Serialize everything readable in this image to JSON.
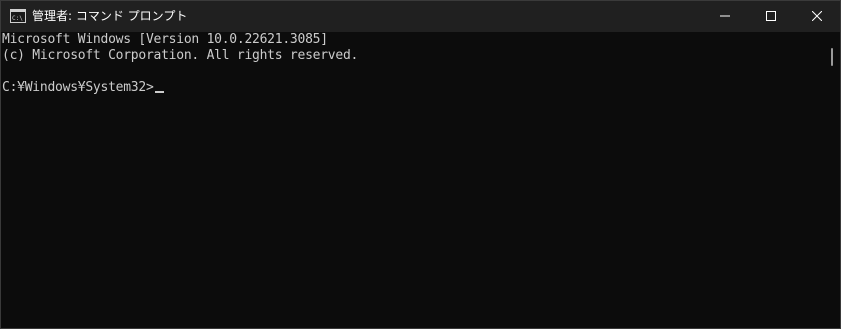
{
  "window": {
    "title": "管理者: コマンド プロンプト",
    "app_icon": "cmd-icon",
    "controls": {
      "minimize_icon": "minimize-icon",
      "maximize_icon": "maximize-icon",
      "close_icon": "close-icon"
    }
  },
  "console": {
    "line1": "Microsoft Windows [Version 10.0.22621.3085]",
    "line2": "(c) Microsoft Corporation. All rights reserved.",
    "prompt": "C:¥Windows¥System32>"
  },
  "colors": {
    "titlebar": "#202020",
    "background": "#0c0c0c",
    "text": "#cccccc"
  }
}
